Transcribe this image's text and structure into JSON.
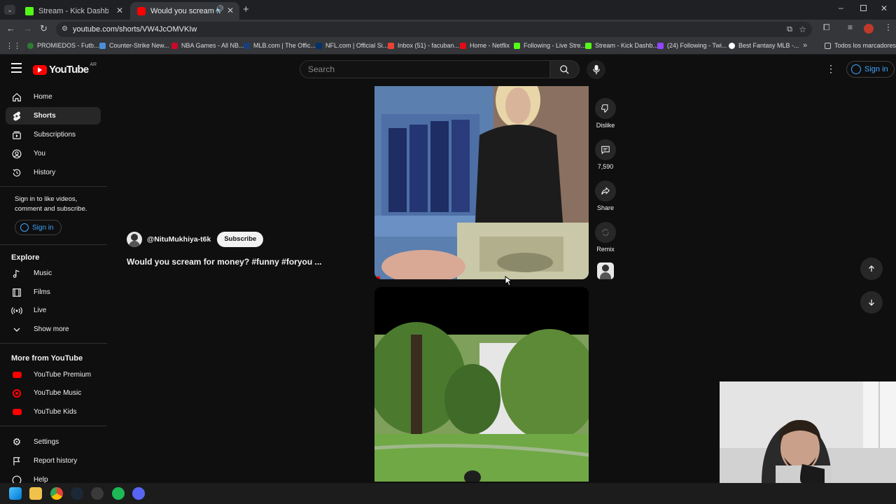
{
  "browser": {
    "tabs": [
      {
        "title": "Stream - Kick Dashboard",
        "active": false,
        "icon": "kick-icon",
        "color": "#53fc18"
      },
      {
        "title": "Would you scream for mon",
        "active": true,
        "icon": "youtube-icon",
        "color": "#ff0000"
      }
    ],
    "url": "youtube.com/shorts/VW4JcOMVKIw",
    "bookmarks": [
      {
        "label": "PROMIEDOS - Futb...",
        "color": "#2e7d32"
      },
      {
        "label": "Counter-Strike New...",
        "color": "#4a90d9"
      },
      {
        "label": "NBA Games - All NB...",
        "color": "#c9082a"
      },
      {
        "label": "MLB.com | The Offic...",
        "color": "#1a3e7a"
      },
      {
        "label": "NFL.com | Official Si...",
        "color": "#013369"
      },
      {
        "label": "Inbox (51) - facuban...",
        "color": "#ea4335"
      },
      {
        "label": "Home - Netflix",
        "color": "#e50914"
      },
      {
        "label": "Following - Live Stre...",
        "color": "#53fc18"
      },
      {
        "label": "Stream - Kick Dashb...",
        "color": "#53fc18"
      },
      {
        "label": "(24) Following - Twi...",
        "color": "#9146ff"
      },
      {
        "label": "Best Fantasy MLB -...",
        "color": "#ffffff"
      }
    ],
    "all_bookmarks": "Todos los marcadores"
  },
  "youtube": {
    "logo": "YouTube",
    "region": "AR",
    "search_placeholder": "Search",
    "sign_in": "Sign in"
  },
  "sidebar": {
    "main": [
      {
        "label": "Home",
        "icon": "home-icon",
        "active": false
      },
      {
        "label": "Shorts",
        "icon": "shorts-icon",
        "active": true
      },
      {
        "label": "Subscriptions",
        "icon": "subscriptions-icon",
        "active": false
      },
      {
        "label": "You",
        "icon": "you-icon",
        "active": false
      },
      {
        "label": "History",
        "icon": "history-icon",
        "active": false
      }
    ],
    "signin_prompt": "Sign in to like videos, comment and subscribe.",
    "signin_button": "Sign in",
    "explore_title": "Explore",
    "explore": [
      {
        "label": "Music",
        "icon": "music-icon"
      },
      {
        "label": "Films",
        "icon": "films-icon"
      },
      {
        "label": "Live",
        "icon": "live-icon"
      },
      {
        "label": "Show more",
        "icon": "chevron-down-icon"
      }
    ],
    "more_title": "More from YouTube",
    "more": [
      {
        "label": "YouTube Premium",
        "icon": "youtube-premium-icon"
      },
      {
        "label": "YouTube Music",
        "icon": "youtube-music-icon"
      },
      {
        "label": "YouTube Kids",
        "icon": "youtube-kids-icon"
      }
    ],
    "bottom": [
      {
        "label": "Settings",
        "icon": "settings-icon"
      },
      {
        "label": "Report history",
        "icon": "flag-icon"
      },
      {
        "label": "Help",
        "icon": "help-icon"
      }
    ]
  },
  "short": {
    "channel": "@NituMukhiya-t6k",
    "subscribe": "Subscribe",
    "title": "Would you scream for money? #funny #foryou ..."
  },
  "actions": [
    {
      "label": "Dislike",
      "icon": "dislike-icon"
    },
    {
      "label": "7,590",
      "icon": "comment-icon"
    },
    {
      "label": "Share",
      "icon": "share-icon"
    },
    {
      "label": "Remix",
      "icon": "remix-icon"
    }
  ]
}
